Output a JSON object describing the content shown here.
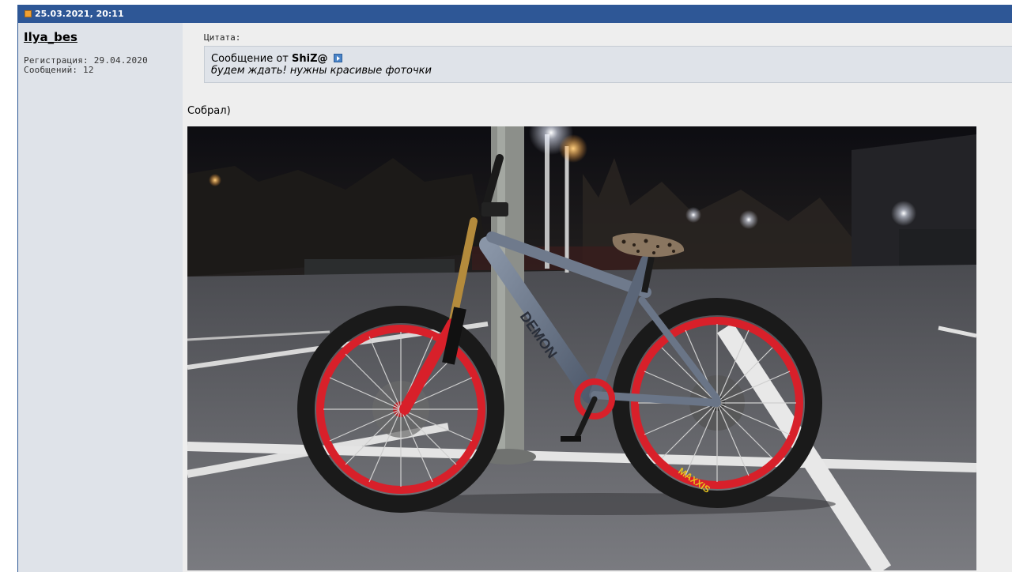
{
  "post": {
    "date": "25.03.2021, 20:11",
    "author": {
      "username": "Ilya_bes",
      "registration": "Регистрация: 29.04.2020",
      "messages": "Сообщений: 12"
    },
    "quote": {
      "label": "Цитата:",
      "from_prefix": "Сообщение от",
      "author": "ShiZ@",
      "text": "будем ждать! нужны красивые фоточки"
    },
    "text": "Собрал)",
    "image": {
      "subject": "bicycle-photo",
      "lettering": [
        "MAXXIS",
        "DEMON"
      ]
    }
  },
  "colors": {
    "header_bg": "#2e5796",
    "user_col_bg": "#dfe3e9",
    "content_bg": "#eeeeee",
    "quote_bg": "#dfe3e9",
    "rim_red": "#d8202a"
  }
}
